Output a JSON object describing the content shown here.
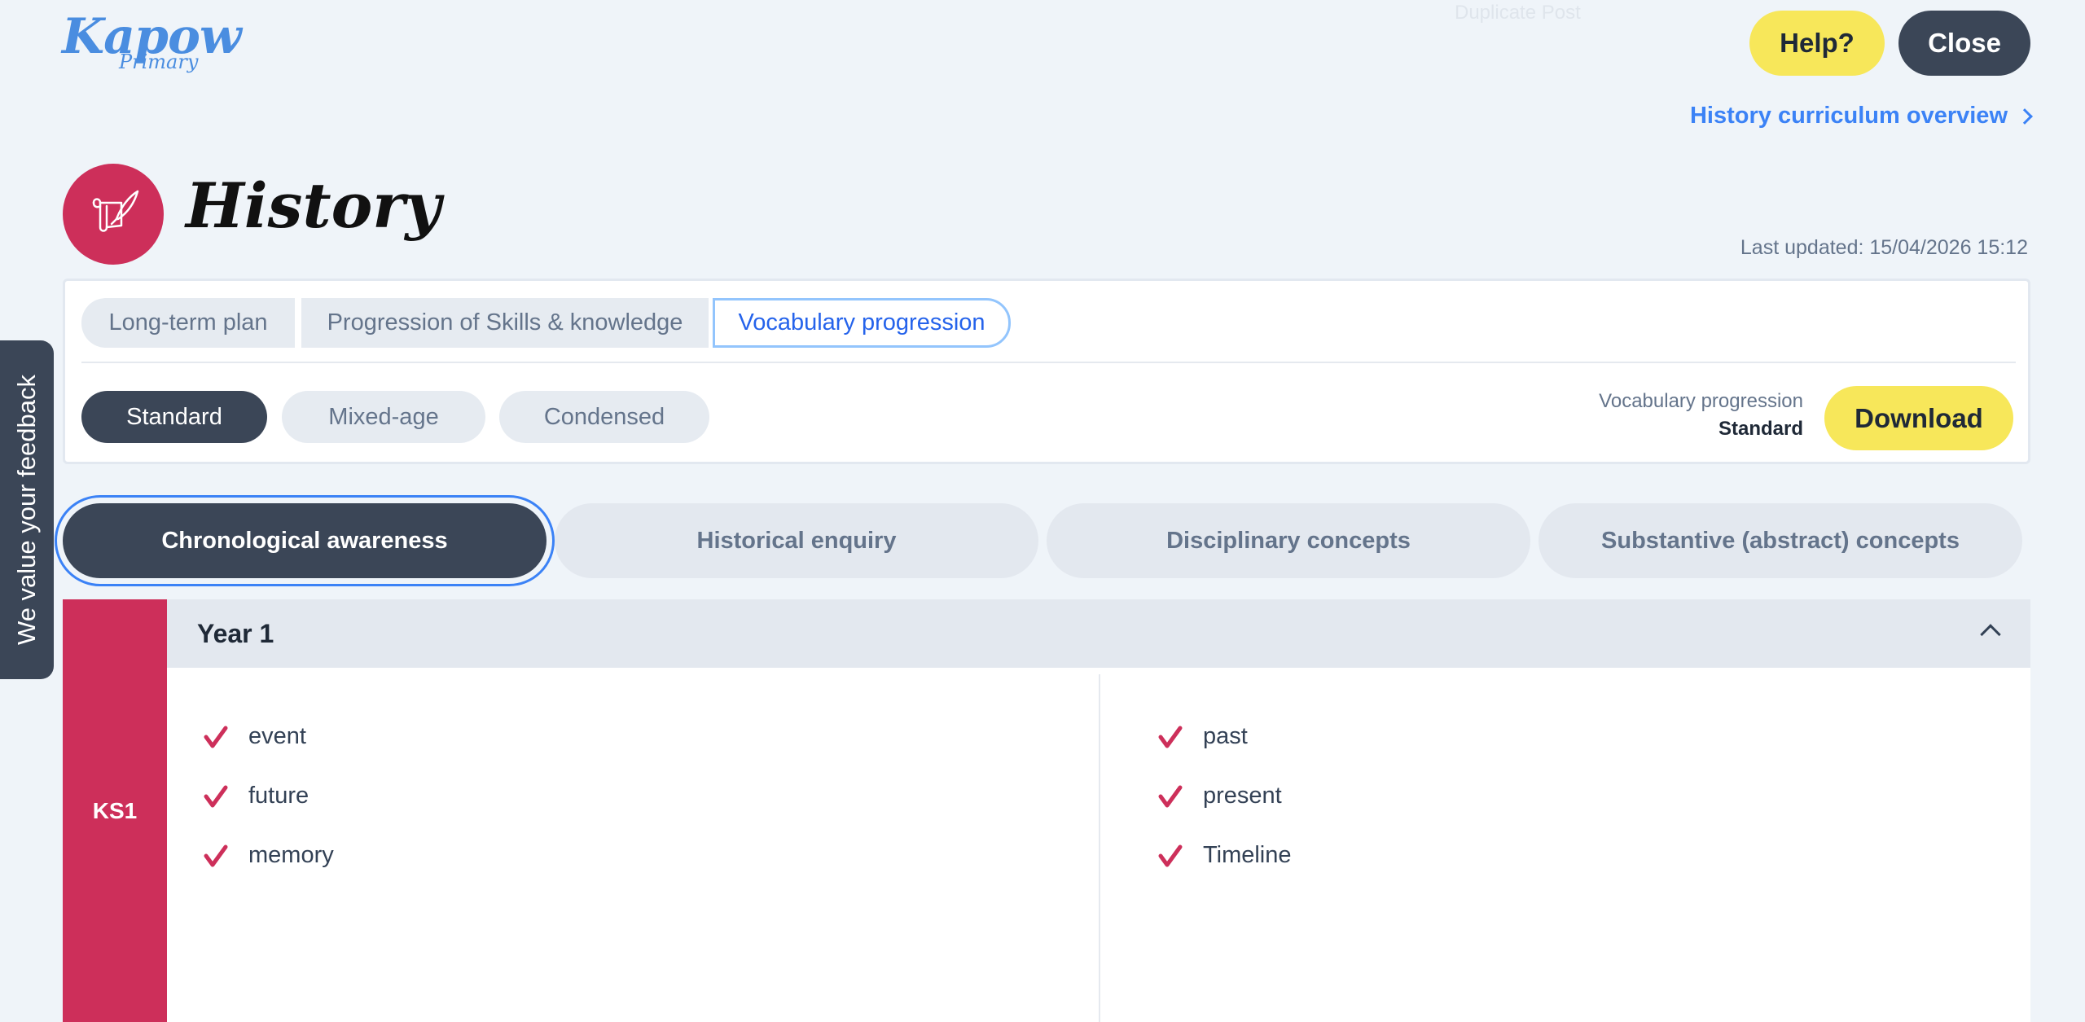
{
  "brand": {
    "name": "Kapow",
    "sub": "Primary"
  },
  "ghost_text": "Duplicate Post",
  "header": {
    "help_label": "Help?",
    "close_label": "Close",
    "overview_link": "History curriculum overview"
  },
  "subject": {
    "title": "History",
    "last_updated": "Last updated: 15/04/2026 15:12"
  },
  "tabs": [
    {
      "label": "Long-term plan",
      "active": false
    },
    {
      "label": "Progression of Skills & knowledge",
      "active": false
    },
    {
      "label": "Vocabulary progression",
      "active": true
    }
  ],
  "modes": [
    {
      "label": "Standard",
      "active": true
    },
    {
      "label": "Mixed-age",
      "active": false
    },
    {
      "label": "Condensed",
      "active": false
    }
  ],
  "download": {
    "line1": "Vocabulary progression",
    "line2": "Standard",
    "button_label": "Download"
  },
  "categories": [
    {
      "label": "Chronological awareness",
      "active": true
    },
    {
      "label": "Historical enquiry",
      "active": false
    },
    {
      "label": "Disciplinary concepts",
      "active": false
    },
    {
      "label": "Substantive (abstract) concepts",
      "active": false
    }
  ],
  "key_stage": "KS1",
  "year": {
    "label": "Year 1",
    "left_words": [
      "event",
      "future",
      "memory"
    ],
    "right_words": [
      "past",
      "present",
      "Timeline"
    ]
  },
  "feedback_label": "We value your feedback",
  "colors": {
    "accent_red": "#cd2f5a",
    "dark": "#3b4657",
    "yellow": "#f7e75a",
    "link_blue": "#3b82f6"
  }
}
